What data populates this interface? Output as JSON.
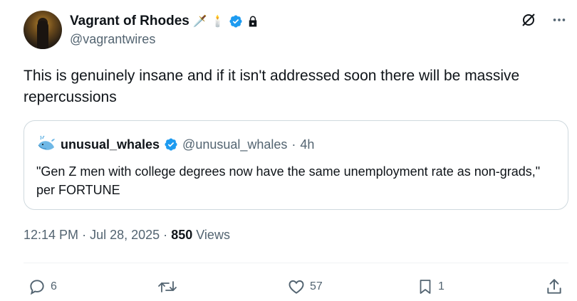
{
  "author": {
    "display_name": "Vagrant of Rhodes",
    "name_emojis": [
      "🗡️",
      "🕯️"
    ],
    "handle": "@vagrantwires",
    "verified": true,
    "protected": true
  },
  "tweet": {
    "text": "This is genuinely insane and if it isn't addressed soon there will be massive repercussions"
  },
  "quoted_tweet": {
    "display_name": "unusual_whales",
    "handle": "@unusual_whales",
    "separator": "·",
    "time": "4h",
    "verified": true,
    "text": "\"Gen Z men with college degrees now have the same unemployment rate as non-grads,\" per FORTUNE"
  },
  "meta": {
    "time": "12:14 PM",
    "separator": "·",
    "date": "Jul 28, 2025",
    "views_count": "850",
    "views_label": "Views"
  },
  "actions": {
    "replies": "6",
    "likes": "57",
    "bookmarks": "1"
  },
  "icons": {
    "top": [
      "grok-icon",
      "more-icon"
    ],
    "actions": [
      "reply-icon",
      "retweet-icon",
      "like-icon",
      "bookmark-icon",
      "share-icon"
    ]
  },
  "colors": {
    "verified": "#1d9bf0",
    "secondary_text": "#536471",
    "border": "#cfd9de"
  }
}
